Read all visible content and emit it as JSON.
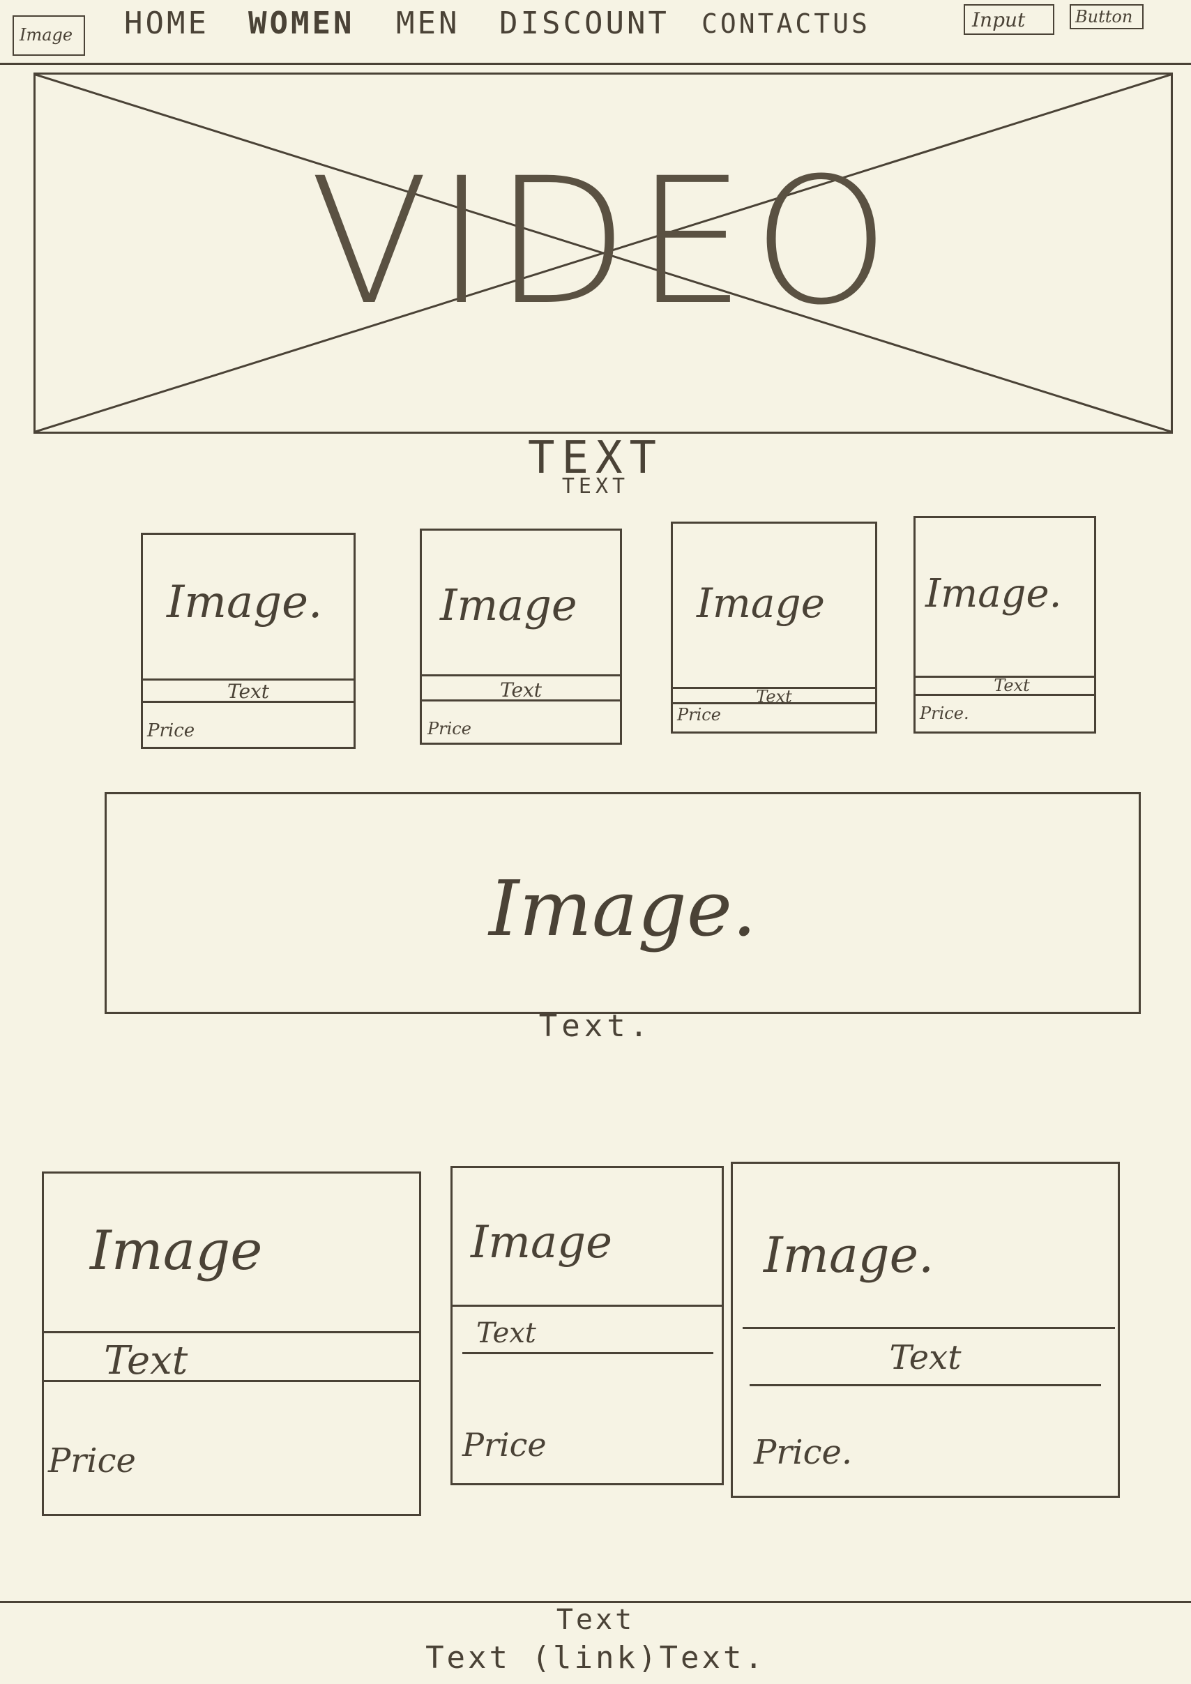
{
  "header": {
    "logo_label": "Image",
    "nav": [
      "HOME",
      "WOMEN",
      "MEN",
      "DISCOUNT",
      "CONTACTUS"
    ],
    "input_label": "Input",
    "button_label": "Button"
  },
  "hero": {
    "video_label": "VIDEO",
    "title": "TEXT",
    "subtitle": "TEXT"
  },
  "products_small": [
    {
      "image": "Image.",
      "text": "Text",
      "price": "Price"
    },
    {
      "image": "Image",
      "text": "Text",
      "price": "Price"
    },
    {
      "image": "Image",
      "text": "Text",
      "price": "Price"
    },
    {
      "image": "Image.",
      "text": "Text",
      "price": "Price."
    }
  ],
  "banner": {
    "image": "Image.",
    "caption": "Text."
  },
  "products_large": [
    {
      "image": "Image",
      "text": "Text",
      "price": "Price"
    },
    {
      "image": "Image",
      "text": "Text",
      "price": "Price"
    },
    {
      "image": "Image.",
      "text": "Text",
      "price": "Price."
    }
  ],
  "footer": {
    "line1": "Text",
    "line2_prefix": "Text",
    "link": "(link)",
    "line2_suffix": "Text."
  }
}
